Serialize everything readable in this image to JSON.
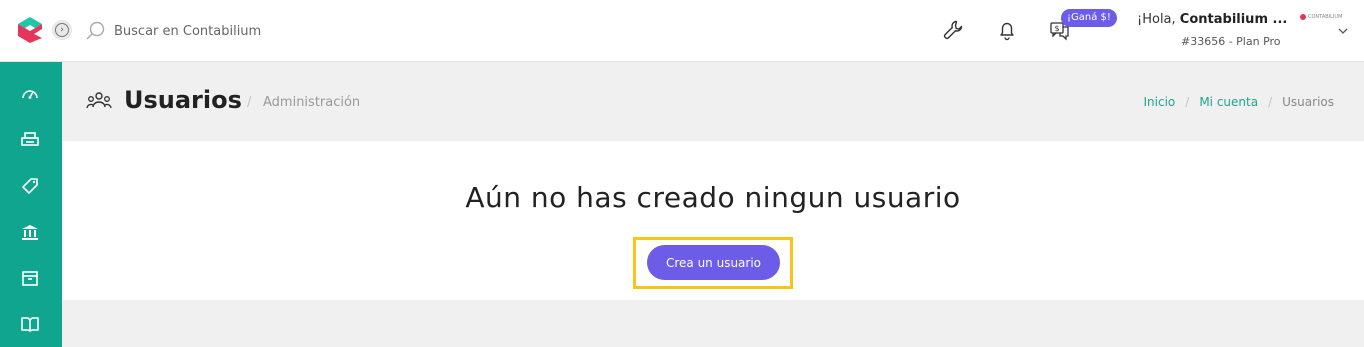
{
  "header": {
    "search_placeholder": "Buscar en Contabilium",
    "badge": "¡Ganá $!",
    "greeting_prefix": "¡Hola, ",
    "user_name": "Contabilium ...",
    "account_info": "#33656 - Plan Pro",
    "mini_logo_text": "CONTABILIUM"
  },
  "page": {
    "title": "Usuarios",
    "subtitle": "Administración",
    "sep": "/"
  },
  "breadcrumb": {
    "items": [
      "Inicio",
      "Mi cuenta",
      "Usuarios"
    ],
    "sep": "/"
  },
  "content": {
    "empty_message": "Aún no has creado ningun usuario",
    "create_button": "Crea un usuario"
  },
  "sidebar": {
    "icons": [
      "dashboard-icon",
      "printer-icon",
      "tag-icon",
      "bank-icon",
      "box-icon",
      "book-icon"
    ]
  },
  "colors": {
    "sidebar": "#0fa58e",
    "accent": "#6c5ce7",
    "highlight": "#f5c518",
    "link": "#1fa58e"
  }
}
